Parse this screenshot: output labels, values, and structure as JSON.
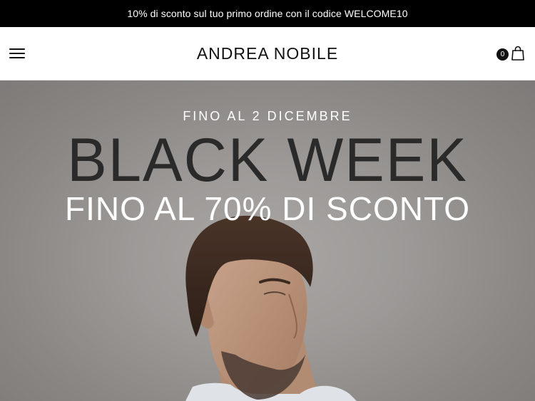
{
  "announcement": {
    "text": "10% di sconto sul tuo primo ordine con il codice WELCOME10"
  },
  "header": {
    "logo": "ANDREA NOBILE",
    "menu_icon": "hamburger-menu-icon",
    "cart_icon": "shopping-bag-icon",
    "cart_count": "0"
  },
  "hero": {
    "eyebrow": "FINO AL 2 DICEMBRE",
    "title": "BLACK WEEK",
    "subtitle": "FINO AL 70% DI SCONTO",
    "colors": {
      "title": "#2a2a2a",
      "text": "#ffffff",
      "background": "#9d9a98"
    }
  }
}
